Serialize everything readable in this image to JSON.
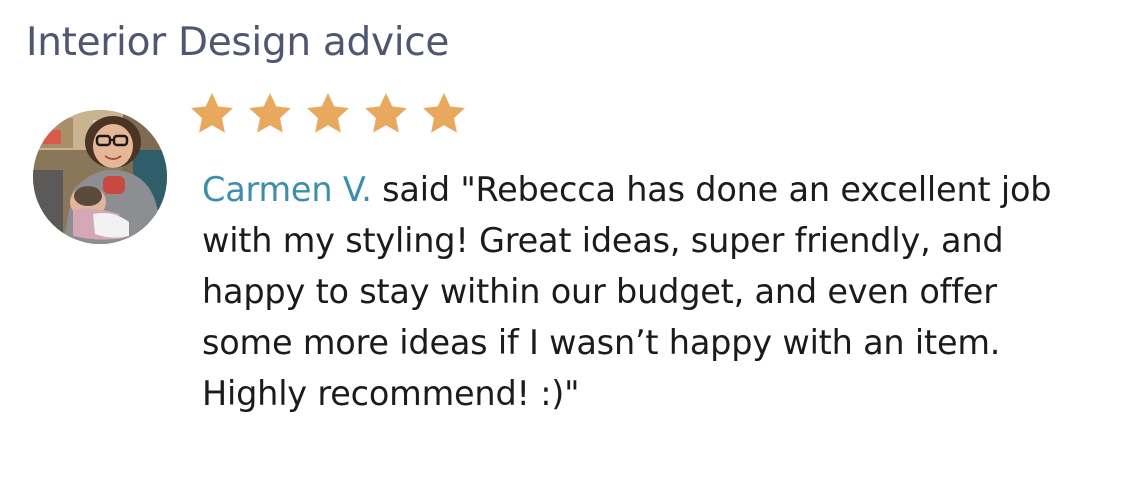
{
  "section_title": "Interior Design advice",
  "review": {
    "rating": 5,
    "max_rating": 5,
    "star_color": "#e8a95f",
    "reviewer_name": "Carmen V.",
    "reviewer_color": "#3c8eac",
    "quote_text": " said \"Rebecca has done an excellent job with my styling! Great ideas, super friendly, and happy to stay within our budget, and even offer some more ideas if I wasn’t happy with an item. Highly recommend! :)\""
  }
}
